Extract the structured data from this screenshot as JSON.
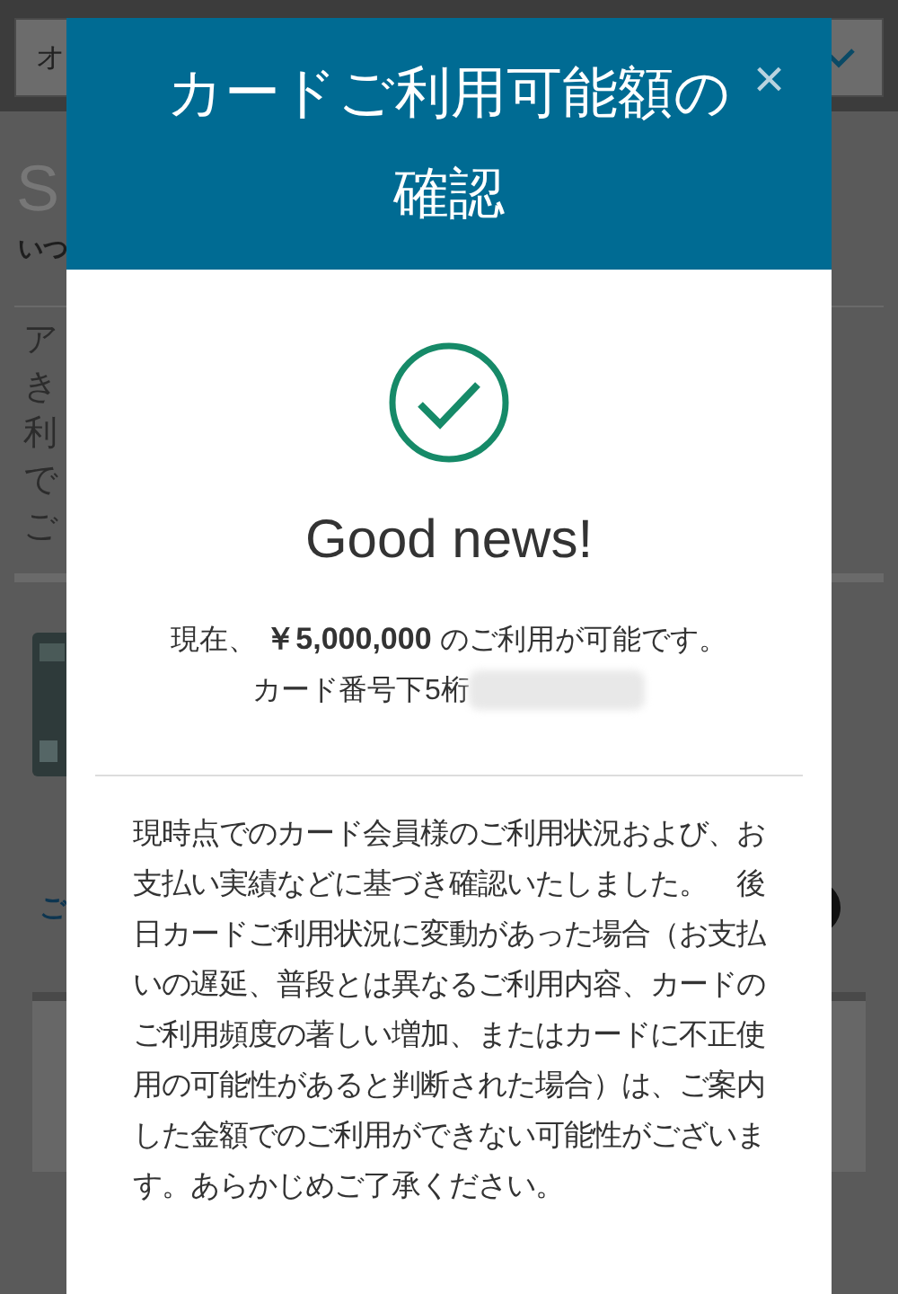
{
  "background_page": {
    "dropdown": {
      "value": "オ"
    },
    "heading": "S",
    "subheading": "いつ",
    "notice_lines": [
      "ア",
      "き",
      "利",
      "で",
      "ご"
    ],
    "link": "ご"
  },
  "dialog": {
    "title": "カードご利用可能額の確認",
    "close": "×",
    "status_heading": "Good news!",
    "available_amount": "現在、 **￥5,000,000** のご利用が可能です。",
    "card_number_label": "カード番号下5桁",
    "disclaimer": "現時点でのカード会員様のご利用状況および、お支払い実績などに基づき確認いたしました。　後日カードご利用状況に変動があった場合（お支払いの遅延、普段とは異なるご利用内容、カードのご利用頻度の著しい増加、またはカードに不正使用の可能性があると判断された場合）は、ご案内した金額でのご利用ができない可能性がございます。あらかじめご了承ください。"
  }
}
